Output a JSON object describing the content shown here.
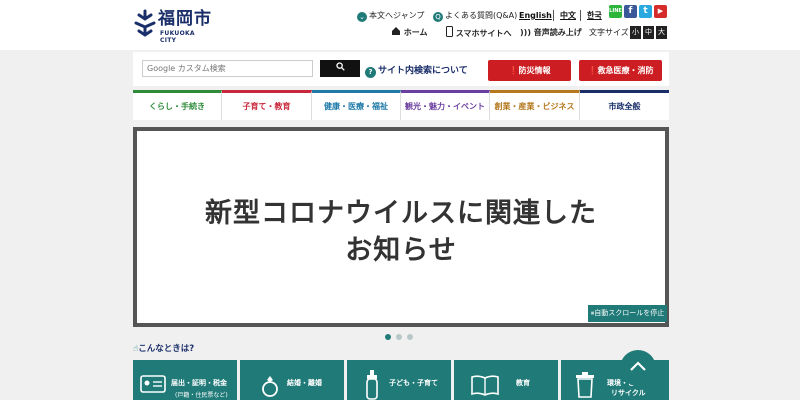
{
  "header": {
    "logo_text": "福岡市",
    "logo_sub": "FUKUOKA CITY",
    "jump_text": "本文へジャンプ",
    "faq_text": "よくある質問(Q&A)",
    "lang_en": "English",
    "lang_zh": "中文",
    "lang_ko": "한국",
    "home": "ホーム",
    "smartphone": "スマホサイトへ",
    "read_aloud": "音声読み上げ",
    "font_size_label": "文字サイズ",
    "size_small": "小",
    "size_mid": "中",
    "size_large": "大",
    "sns": {
      "line": "LINE",
      "facebook": "f",
      "twitter": "t",
      "youtube": "▶"
    }
  },
  "search": {
    "placeholder": "Google カスタム検索",
    "help": "サイト内検索について",
    "bousai": "防災情報",
    "kyukyu": "救急医療・消防"
  },
  "nav": {
    "items": [
      {
        "label": "くらし・手続き",
        "color": "#2e8b3a"
      },
      {
        "label": "子育て・教育",
        "color": "#c8283c"
      },
      {
        "label": "健康・医療・福祉",
        "color": "#1f7aa8"
      },
      {
        "label": "観光・魅力・イベント",
        "color": "#6b3fa0"
      },
      {
        "label": "創業・産業・ビジネス",
        "color": "#b5781e"
      },
      {
        "label": "市政全般",
        "color": "#1a2f6a"
      }
    ]
  },
  "hero": {
    "line1": "新型コロナウイルスに関連した",
    "line2": "お知らせ",
    "stop_label": "自動スクロールを停止"
  },
  "konna": "こんなときは?",
  "tiles": [
    {
      "label": "届出・証明・税金",
      "sub": "(戸籍・住民票など)"
    },
    {
      "label": "結婚・離婚",
      "sub": ""
    },
    {
      "label": "子ども・子育て",
      "sub": ""
    },
    {
      "label": "教育",
      "sub": ""
    },
    {
      "label": "環境・ごみ・",
      "sub": "リサイクル"
    }
  ],
  "colors": {
    "teal": "#1f7a78",
    "red": "#cc1d22",
    "navy": "#1a2f6a"
  }
}
